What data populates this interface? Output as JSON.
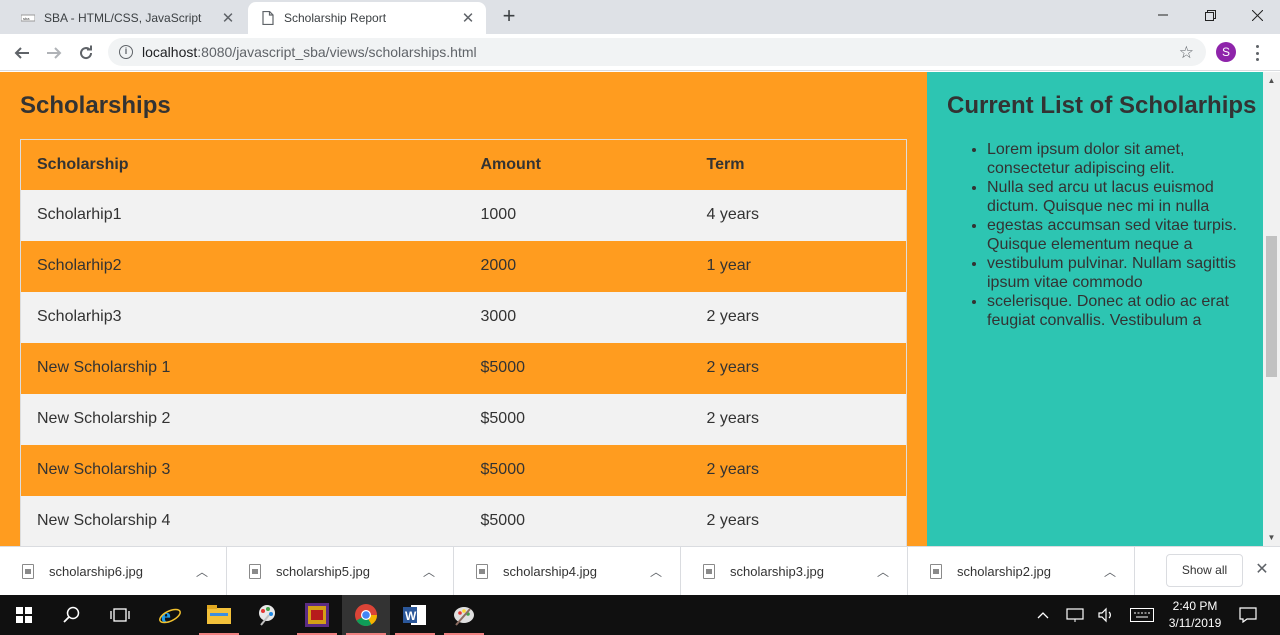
{
  "browser": {
    "tabs": [
      {
        "title": "SBA - HTML/CSS, JavaScript",
        "active": false
      },
      {
        "title": "Scholarship Report",
        "active": true
      }
    ],
    "url_host": "localhost",
    "url_path": ":8080/javascript_sba/views/scholarships.html",
    "profile_initial": "S"
  },
  "page": {
    "main_title": "Scholarships",
    "table": {
      "headers": [
        "Scholarship",
        "Amount",
        "Term"
      ],
      "rows": [
        [
          "Scholarhip1",
          "1000",
          "4 years"
        ],
        [
          "Scholarhip2",
          "2000",
          "1 year"
        ],
        [
          "Scholarhip3",
          "3000",
          "2 years"
        ],
        [
          "New Scholarship 1",
          "$5000",
          "2 years"
        ],
        [
          "New Scholarship 2",
          "$5000",
          "2 years"
        ],
        [
          "New Scholarship 3",
          "$5000",
          "2 years"
        ],
        [
          "New Scholarship 4",
          "$5000",
          "2 years"
        ]
      ]
    },
    "aside_title": "Current List of Scholarhips",
    "aside_items": [
      "Lorem ipsum dolor sit amet, consectetur adipiscing elit.",
      "Nulla sed arcu ut lacus euismod dictum. Quisque nec mi in nulla",
      "egestas accumsan sed vitae turpis. Quisque elementum neque a",
      "vestibulum pulvinar. Nullam sagittis ipsum vitae commodo",
      "scelerisque. Donec at odio ac erat feugiat convallis. Vestibulum a"
    ],
    "colors": {
      "main_bg": "#ff9c1f",
      "aside_bg": "#2dc5b2",
      "stripe": "#f2f2f2"
    }
  },
  "downloads": {
    "files": [
      "scholarship6.jpg",
      "scholarship5.jpg",
      "scholarship4.jpg",
      "scholarship3.jpg",
      "scholarship2.jpg"
    ],
    "show_all_label": "Show all"
  },
  "taskbar": {
    "apps": [
      "start-icon",
      "search-icon",
      "task-view-icon",
      "internet-explorer-icon",
      "file-explorer-icon",
      "paint-app-icon",
      "game-app-icon",
      "chrome-icon",
      "word-icon",
      "paint-3d-icon"
    ],
    "time": "2:40 PM",
    "date": "3/11/2019"
  }
}
